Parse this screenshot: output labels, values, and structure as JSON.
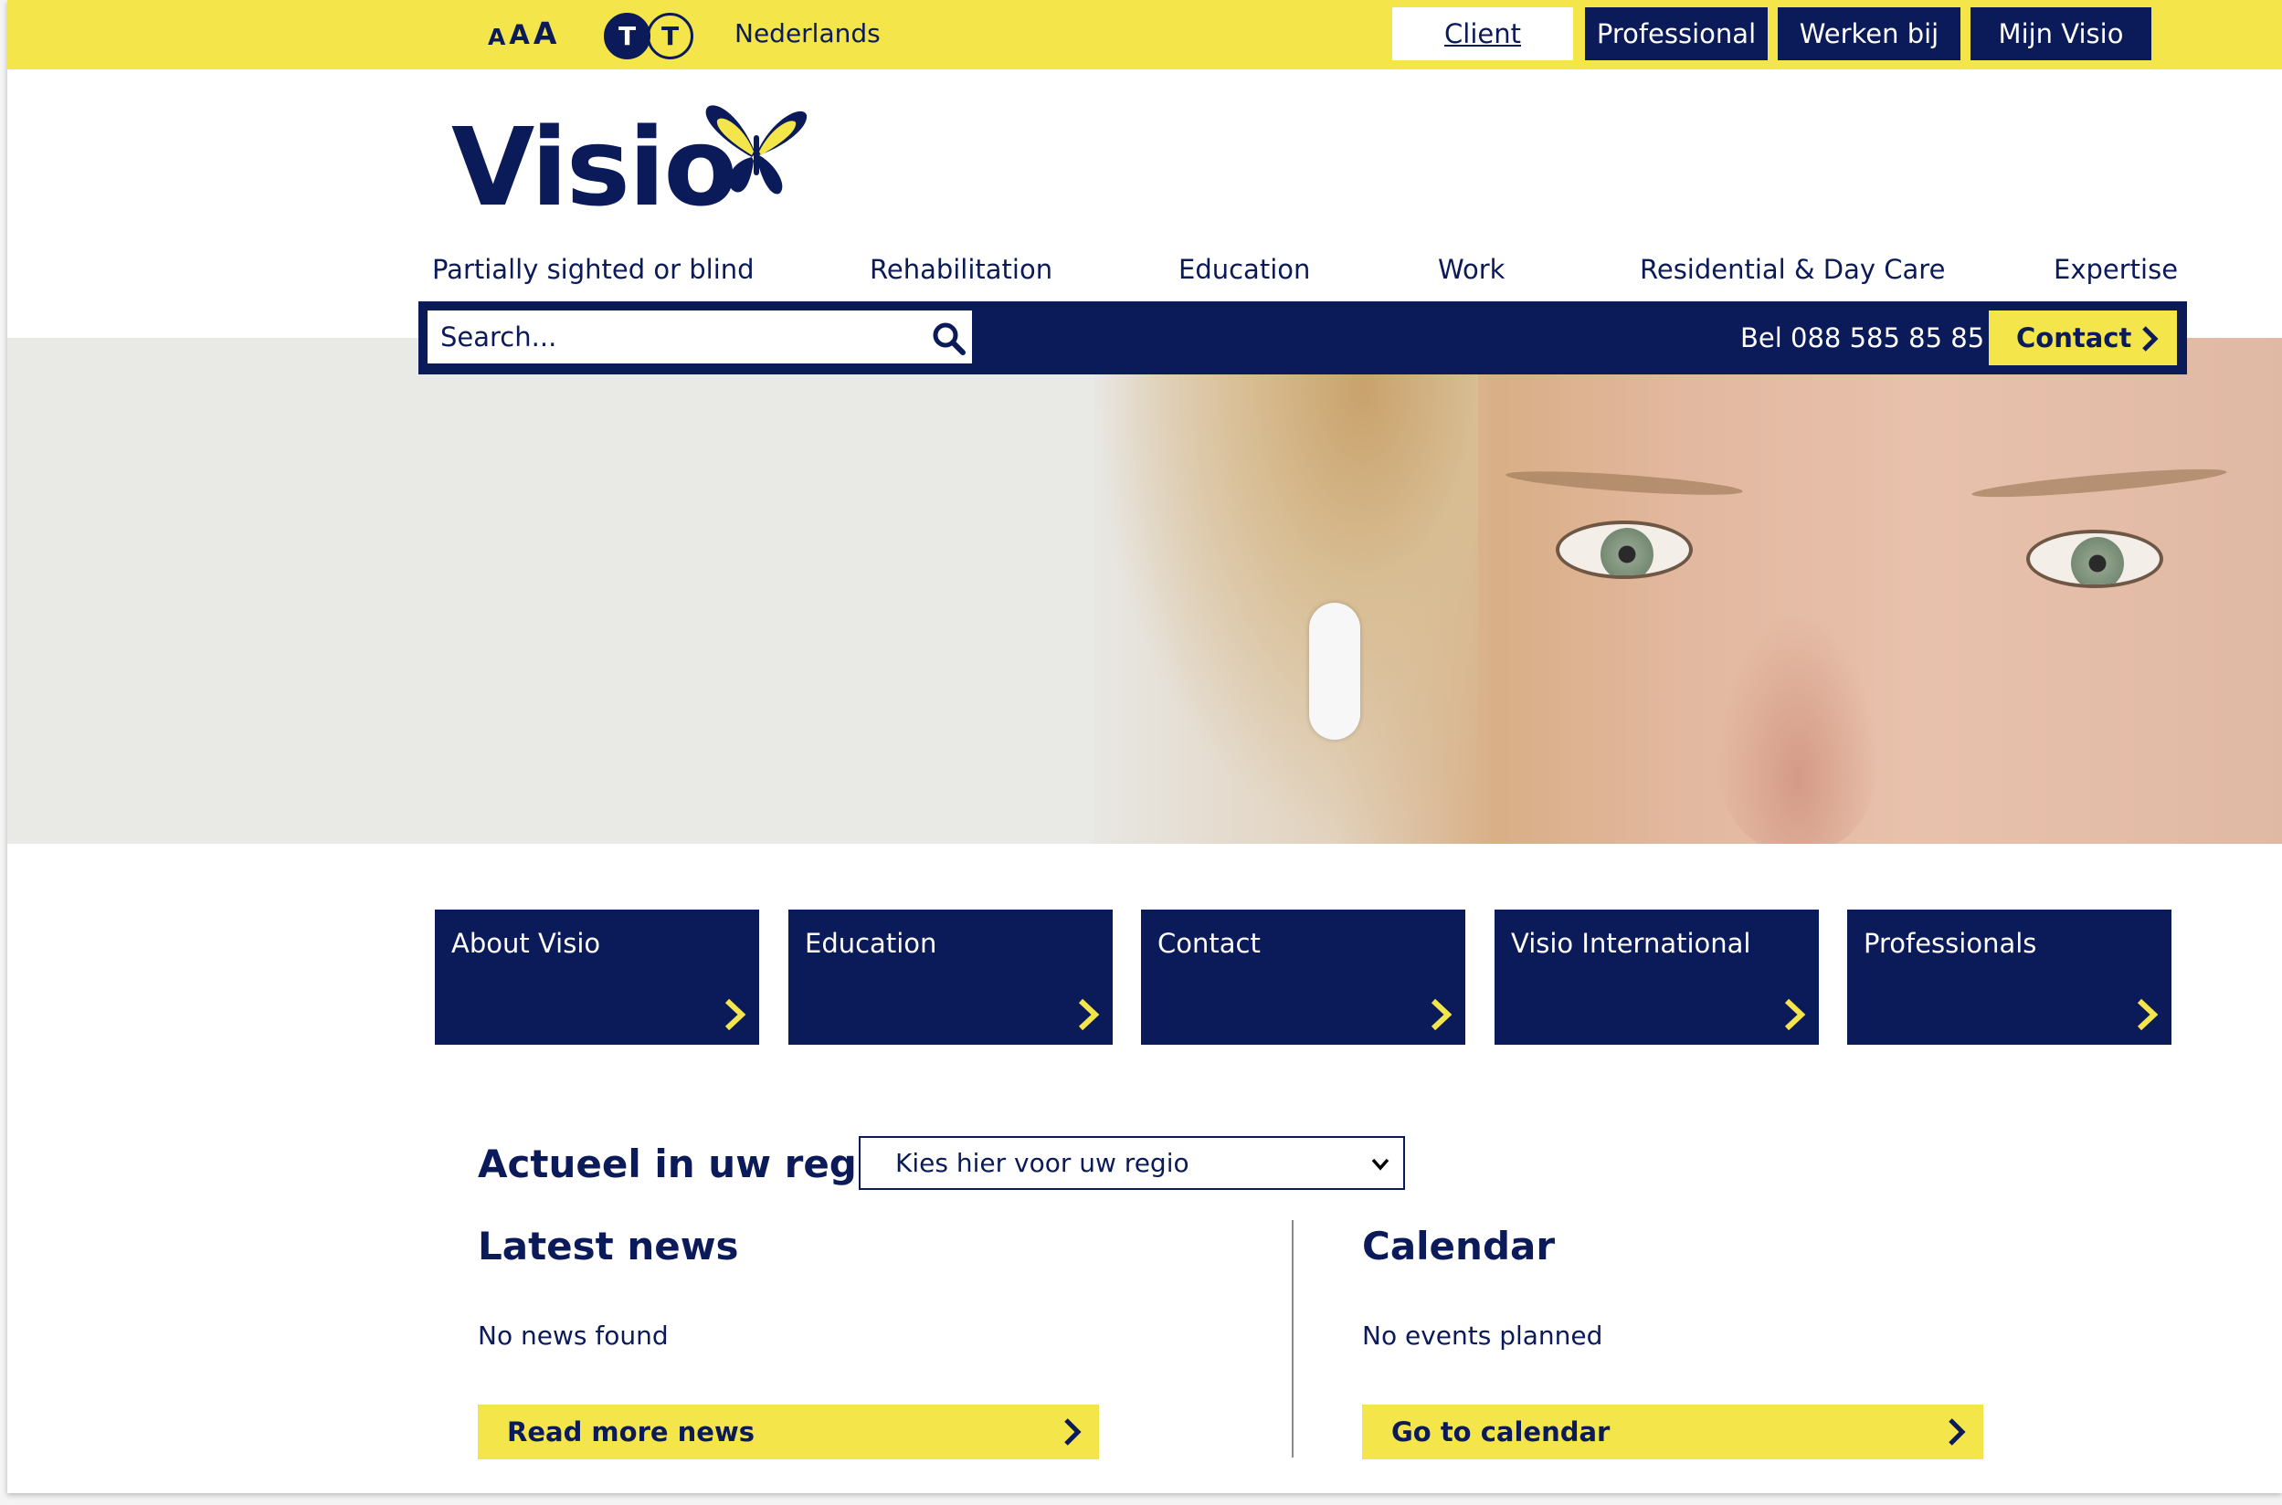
{
  "topbar": {
    "font_size_labels": [
      "A",
      "A",
      "A"
    ],
    "contrast_labels": [
      "T",
      "T"
    ],
    "language": "Nederlands",
    "audience_tabs": [
      {
        "label": "Client",
        "active": true
      },
      {
        "label": "Professional",
        "active": false
      },
      {
        "label": "Werken bij",
        "active": false
      },
      {
        "label": "Mijn Visio",
        "active": false
      }
    ]
  },
  "logo": {
    "text": "Visio",
    "icon": "butterfly-icon"
  },
  "nav": {
    "items": [
      "Partially sighted or blind",
      "Rehabilitation",
      "Education",
      "Work",
      "Residential & Day Care",
      "Expertise"
    ]
  },
  "search": {
    "placeholder": "Search..."
  },
  "phone": "Bel 088 585 85 85",
  "contact_button": "Contact",
  "tiles": [
    "About Visio",
    "Education",
    "Contact",
    "Visio International",
    "Professionals"
  ],
  "region": {
    "title": "Actueel in uw regio",
    "select_value": "Kies hier voor uw regio"
  },
  "news": {
    "title": "Latest news",
    "empty": "No news found",
    "button": "Read more news"
  },
  "calendar": {
    "title": "Calendar",
    "empty": "No events planned",
    "button": "Go to calendar"
  },
  "colors": {
    "navy": "#0b1a58",
    "yellow": "#f3e54a",
    "hero_bg": "#e9e9e6"
  }
}
